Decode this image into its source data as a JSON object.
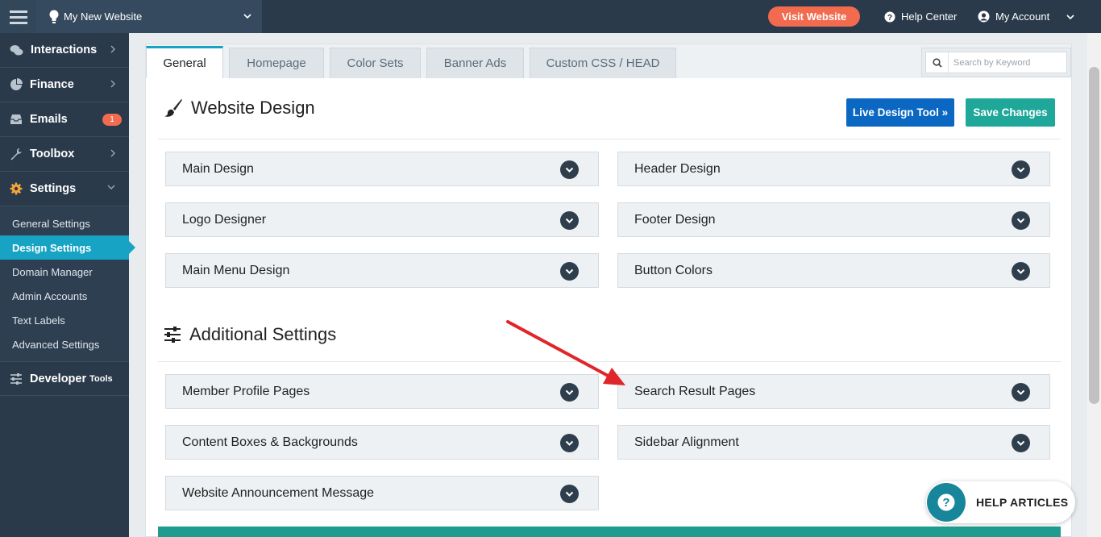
{
  "topbar": {
    "site_name": "My New Website",
    "visit_button": "Visit Website",
    "help_center": "Help Center",
    "my_account": "My Account"
  },
  "sidebar": {
    "items": [
      {
        "label": "Interactions"
      },
      {
        "label": "Finance"
      },
      {
        "label": "Emails",
        "badge": "1"
      },
      {
        "label": "Toolbox"
      },
      {
        "label": "Settings"
      }
    ],
    "settings_submenu": [
      "General Settings",
      "Design Settings",
      "Domain Manager",
      "Admin Accounts",
      "Text Labels",
      "Advanced Settings"
    ],
    "developer": {
      "label": "Developer",
      "suffix": "Tools"
    }
  },
  "tabs": [
    "General",
    "Homepage",
    "Color Sets",
    "Banner Ads",
    "Custom CSS / HEAD"
  ],
  "search": {
    "placeholder": "Search by Keyword"
  },
  "website_design": {
    "title": "Website Design",
    "live_design_button": "Live Design Tool »",
    "save_button": "Save Changes",
    "panels": [
      "Main Design",
      "Header Design",
      "Logo Designer",
      "Footer Design",
      "Main Menu Design",
      "Button Colors"
    ]
  },
  "additional_settings": {
    "title": "Additional Settings",
    "panels": [
      "Member Profile Pages",
      "Search Result Pages",
      "Content Boxes & Backgrounds",
      "Sidebar Alignment",
      "Website Announcement Message"
    ]
  },
  "help_articles": {
    "label": "HELP ARTICLES"
  },
  "colors": {
    "accent": "#17a3c4",
    "visit": "#f26b4f",
    "blue": "#0a67c2",
    "teal": "#1fa79a",
    "arrow": "#e0262b"
  }
}
